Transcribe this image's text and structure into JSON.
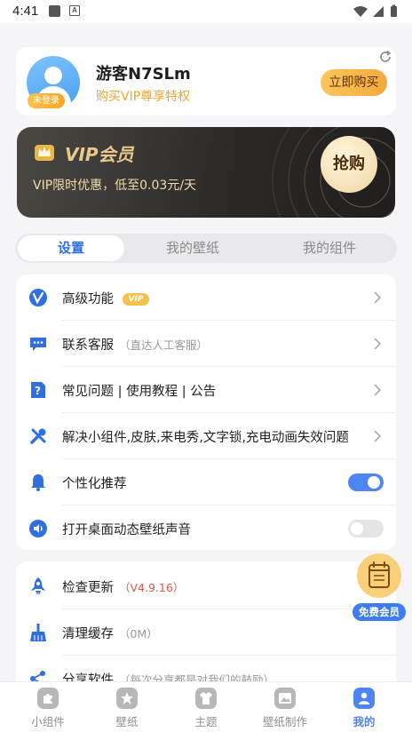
{
  "status_bar": {
    "time": "4:41",
    "a_glyph": "A"
  },
  "profile": {
    "username": "游客N7SLm",
    "subtitle": "购买VIP尊享特权",
    "login_badge": "未登录",
    "buy_button": "立即购买"
  },
  "vip_banner": {
    "title": "VIP会员",
    "subtitle": "VIP限时优惠，低至0.03元/天",
    "grab_button": "抢购"
  },
  "tabs": [
    {
      "label": "设置",
      "active": true
    },
    {
      "label": "我的壁纸",
      "active": false
    },
    {
      "label": "我的组件",
      "active": false
    }
  ],
  "settings": [
    {
      "label": "高级功能",
      "tag": "VIP",
      "icon": "v-badge-icon",
      "control": "chevron"
    },
    {
      "label": "联系客服",
      "hint": "（直达人工客服）",
      "icon": "chat-icon",
      "control": "chevron"
    },
    {
      "label": "常见问题 | 使用教程 | 公告",
      "icon": "help-doc-icon",
      "control": "chevron"
    },
    {
      "label": "解决小组件,皮肤,来电秀,文字锁,充电动画失效问题",
      "icon": "tools-icon",
      "control": "chevron"
    },
    {
      "label": "个性化推荐",
      "icon": "bell-icon",
      "control": "toggle",
      "on": true
    },
    {
      "label": "打开桌面动态壁纸声音",
      "icon": "sound-icon",
      "control": "toggle",
      "on": false
    }
  ],
  "other": [
    {
      "label": "检查更新",
      "hint": "（V4.9.16）",
      "hint_color": "red",
      "icon": "rocket-icon"
    },
    {
      "label": "清理缓存",
      "hint": "（0M）",
      "icon": "broom-icon"
    },
    {
      "label": "分享软件",
      "hint": "（每次分享都是对我们的鼓励）",
      "icon": "share-icon"
    }
  ],
  "floating_vip": {
    "label": "免费会员"
  },
  "bottom_nav": [
    {
      "label": "小组件",
      "active": false,
      "icon": "widget-icon"
    },
    {
      "label": "壁纸",
      "active": false,
      "icon": "wallpaper-icon"
    },
    {
      "label": "主题",
      "active": false,
      "icon": "shirt-icon"
    },
    {
      "label": "壁纸制作",
      "active": false,
      "icon": "wallpaper-make-icon"
    },
    {
      "label": "我的",
      "active": true,
      "icon": "person-icon"
    }
  ],
  "colors": {
    "accent": "#4e85f5",
    "gold": "#f5a623",
    "vip_text": "#e9c88c"
  }
}
